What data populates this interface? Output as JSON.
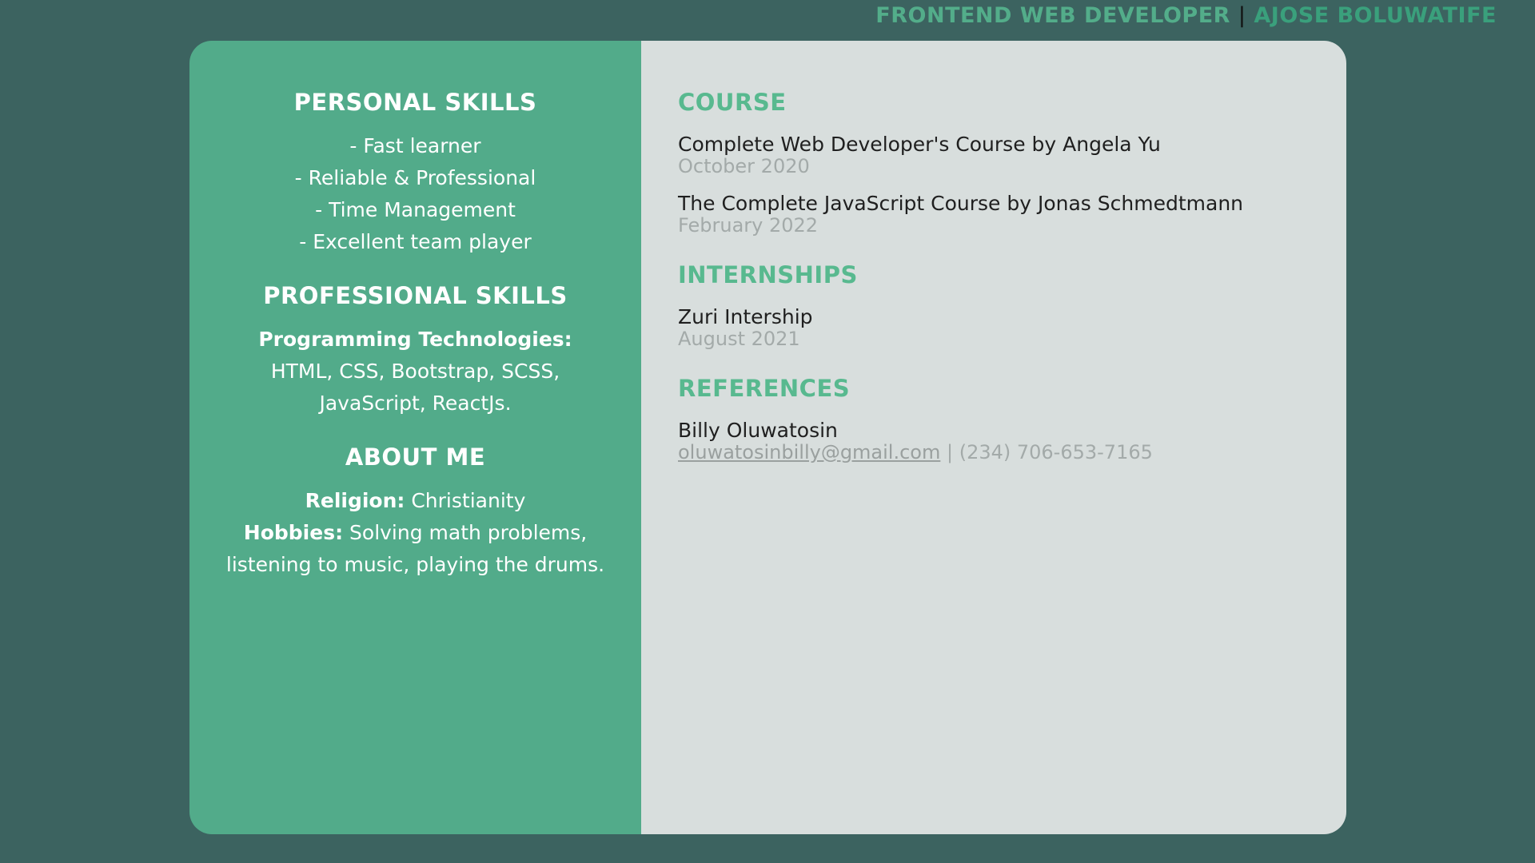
{
  "header": {
    "role": "FRONTEND WEB DEVELOPER",
    "separator": "|",
    "name": "AJOSE BOLUWATIFE"
  },
  "left": {
    "personal_skills": {
      "title": "PERSONAL SKILLS",
      "items": [
        "- Fast learner",
        "- Reliable & Professional",
        "- Time Management",
        "- Excellent team player"
      ]
    },
    "professional_skills": {
      "title": "PROFESSIONAL SKILLS",
      "label": "Programming Technologies:",
      "line1": "HTML, CSS, Bootstrap, SCSS,",
      "line2": "JavaScript, ReactJs."
    },
    "about_me": {
      "title": "ABOUT ME",
      "religion_label": "Religion:",
      "religion_value": " Christianity",
      "hobbies_label": "Hobbies:",
      "hobbies_value": " Solving math problems,",
      "hobbies_line2": "listening to music, playing the drums."
    }
  },
  "right": {
    "course": {
      "title": "COURSE",
      "entries": [
        {
          "title": "Complete Web Developer's Course by Angela Yu",
          "date": "October 2020"
        },
        {
          "title": "The Complete JavaScript Course by Jonas Schmedtmann",
          "date": "February 2022"
        }
      ]
    },
    "internships": {
      "title": "INTERNSHIPS",
      "entries": [
        {
          "title": "Zuri Intership",
          "date": "August 2021"
        }
      ]
    },
    "references": {
      "title": "REFERENCES",
      "name": "Billy Oluwatosin",
      "email": "oluwatosinbilly@gmail.com",
      "phone": " | (234) 706-653-7165"
    }
  },
  "colors": {
    "background": "#3c6360",
    "left_panel": "#52ab8a",
    "right_panel": "#d8dedd",
    "accent": "#58b98f"
  }
}
